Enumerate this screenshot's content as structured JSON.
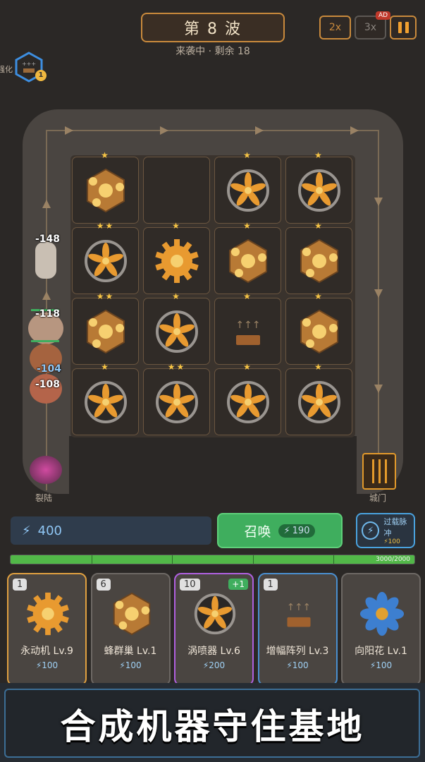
{
  "hud": {
    "wave_title": "第 8 波",
    "wave_status": "来袭中 · 剩余 18",
    "speed_2x": "2x",
    "speed_3x": "3x",
    "ad_label": "AD",
    "upgrade_label": "强化",
    "upgrade_count": "1",
    "upgrade_arrows": "+++"
  },
  "board": {
    "spawn_label": "裂陆",
    "gate_label": "城门",
    "damage_numbers": [
      "-148",
      "-118",
      "-104",
      "-108"
    ],
    "cells": [
      {
        "row": 0,
        "col": 0,
        "unit": "hive",
        "stars": 1
      },
      {
        "row": 0,
        "col": 1,
        "unit": "empty",
        "stars": 0
      },
      {
        "row": 0,
        "col": 2,
        "unit": "turbine",
        "stars": 1
      },
      {
        "row": 0,
        "col": 3,
        "unit": "turbine",
        "stars": 1
      },
      {
        "row": 1,
        "col": 0,
        "unit": "turbine",
        "stars": 2
      },
      {
        "row": 1,
        "col": 1,
        "unit": "gear",
        "stars": 1
      },
      {
        "row": 1,
        "col": 2,
        "unit": "hive",
        "stars": 1
      },
      {
        "row": 1,
        "col": 3,
        "unit": "hive",
        "stars": 1
      },
      {
        "row": 2,
        "col": 0,
        "unit": "hive",
        "stars": 2
      },
      {
        "row": 2,
        "col": 1,
        "unit": "turbine",
        "stars": 1
      },
      {
        "row": 2,
        "col": 2,
        "unit": "amplifier",
        "stars": 1
      },
      {
        "row": 2,
        "col": 3,
        "unit": "hive",
        "stars": 1
      },
      {
        "row": 3,
        "col": 0,
        "unit": "turbine",
        "stars": 1
      },
      {
        "row": 3,
        "col": 1,
        "unit": "turbine",
        "stars": 2
      },
      {
        "row": 3,
        "col": 2,
        "unit": "turbine",
        "stars": 1
      },
      {
        "row": 3,
        "col": 3,
        "unit": "turbine",
        "stars": 1
      }
    ]
  },
  "controls": {
    "energy": "400",
    "summon_label": "召唤",
    "summon_cost": "190",
    "pulse_label": "过载脉冲",
    "pulse_cost": "100",
    "progress_text": "3000/2000",
    "progress_fraction": 1.0
  },
  "cards": [
    {
      "count": "1",
      "name": "永动机 Lv.9",
      "cost": "100",
      "icon": "gear",
      "border": "#e0a040",
      "plus": ""
    },
    {
      "count": "6",
      "name": "蜂群巢 Lv.1",
      "cost": "100",
      "icon": "hive",
      "border": "#6d6864",
      "plus": ""
    },
    {
      "count": "10",
      "name": "涡喷器 Lv.6",
      "cost": "200",
      "icon": "turbine",
      "border": "#b060e0",
      "plus": "+1"
    },
    {
      "count": "1",
      "name": "增幅阵列 Lv.3",
      "cost": "100",
      "icon": "amplifier",
      "border": "#4a8fd0",
      "plus": ""
    },
    {
      "count": "",
      "name": "向阳花 Lv.1",
      "cost": "100",
      "icon": "sunflower",
      "border": "#6d6864",
      "plus": ""
    }
  ],
  "banner": {
    "text": "合成机器守住基地"
  },
  "colors": {
    "accent": "#c98a3c",
    "summon": "#3fae5e",
    "energy": "#8fc6f4",
    "star": "#f6c445"
  }
}
